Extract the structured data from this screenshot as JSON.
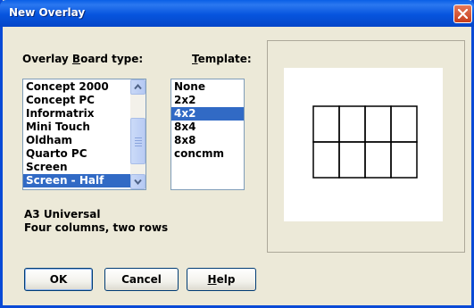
{
  "window": {
    "title": "New Overlay"
  },
  "board_type": {
    "label": "Overlay Board type:",
    "items": [
      "Concept 2000",
      "Concept PC",
      "Informatrix",
      "Mini Touch",
      "Oldham",
      "Quarto PC",
      "Screen",
      "Screen - Half"
    ],
    "selected": "Screen - Half"
  },
  "template": {
    "label": "Template:",
    "items": [
      "None",
      "2x2",
      "4x2",
      "8x4",
      "8x8",
      "concmm"
    ],
    "selected": "4x2"
  },
  "description": {
    "line1": "A3 Universal",
    "line2": "Four columns, two rows"
  },
  "preview": {
    "columns": 4,
    "rows": 2
  },
  "buttons": {
    "ok": "OK",
    "cancel": "Cancel",
    "help": "Help"
  },
  "icons": {
    "close": "close-icon",
    "scroll_up": "arrow-up-icon",
    "scroll_down": "arrow-down-icon"
  },
  "colors": {
    "titlebar": "#0654de",
    "selection": "#316ac5",
    "dialog_bg": "#ece9d8",
    "close": "#c63d1c"
  }
}
